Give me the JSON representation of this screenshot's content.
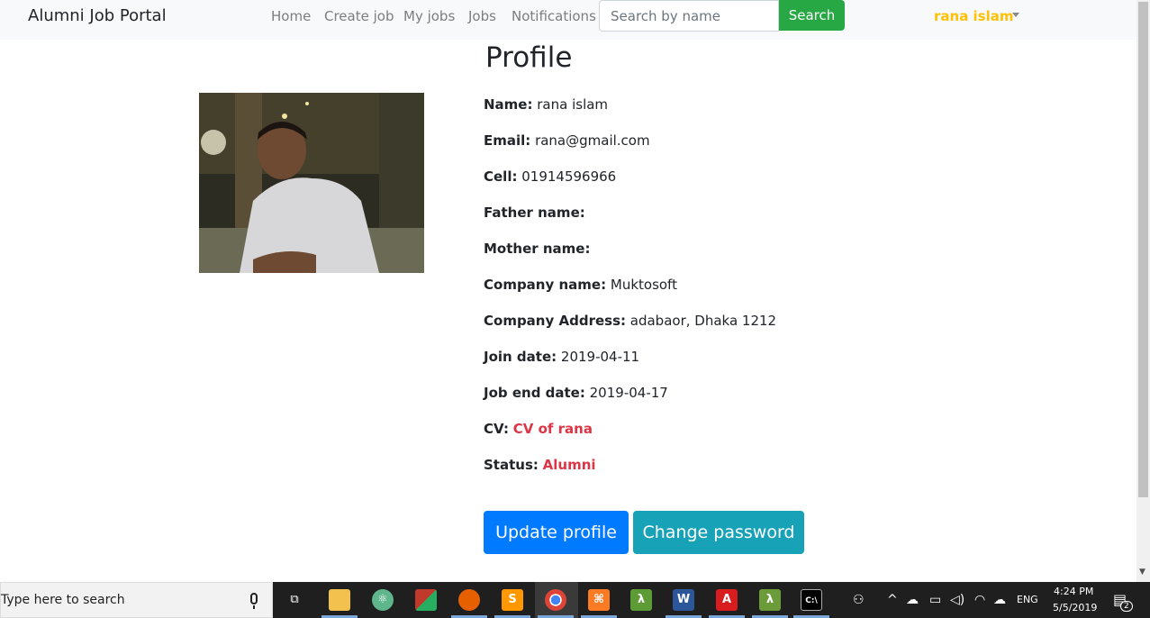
{
  "navbar": {
    "brand": "Alumni Job Portal",
    "links": [
      "Home",
      "Create job",
      "My jobs",
      "Jobs",
      "Notifications"
    ],
    "search_placeholder": "Search by name",
    "search_button": "Search",
    "user": "rana islam",
    "user_color": "#ffc107"
  },
  "profile": {
    "title": "Profile",
    "fields": [
      {
        "label": "Name:",
        "value": "rana islam"
      },
      {
        "label": "Email:",
        "value": "rana@gmail.com"
      },
      {
        "label": "Cell:",
        "value": "01914596966"
      },
      {
        "label": "Father name:",
        "value": ""
      },
      {
        "label": "Mother name:",
        "value": ""
      },
      {
        "label": "Company name:",
        "value": "Muktosoft"
      },
      {
        "label": "Company Address:",
        "value": "adabaor, Dhaka 1212"
      },
      {
        "label": "Join date:",
        "value": "2019-04-11"
      },
      {
        "label": "Job end date:",
        "value": "2019-04-17"
      }
    ],
    "cv_label": "CV:",
    "cv_link": "CV of rana",
    "status_label": "Status:",
    "status_value": "Alumni",
    "update_button": "Update profile",
    "password_button": "Change password"
  },
  "taskbar": {
    "search_placeholder": "Type here to search",
    "language": "ENG",
    "time": "4:24 PM",
    "date": "5/5/2019",
    "notification_count": "2",
    "icons": [
      "task-view-icon",
      "file-explorer-icon",
      "atom-icon",
      "winrar-icon",
      "firefox-icon",
      "sublime-icon",
      "chrome-icon",
      "xampp-icon",
      "lambda-icon",
      "word-icon",
      "acrobat-icon",
      "lambda-alt-icon",
      "terminal-icon"
    ]
  },
  "colors": {
    "primary": "#007bff",
    "info": "#17a2b8",
    "success": "#28a745",
    "danger": "#dc3545"
  }
}
